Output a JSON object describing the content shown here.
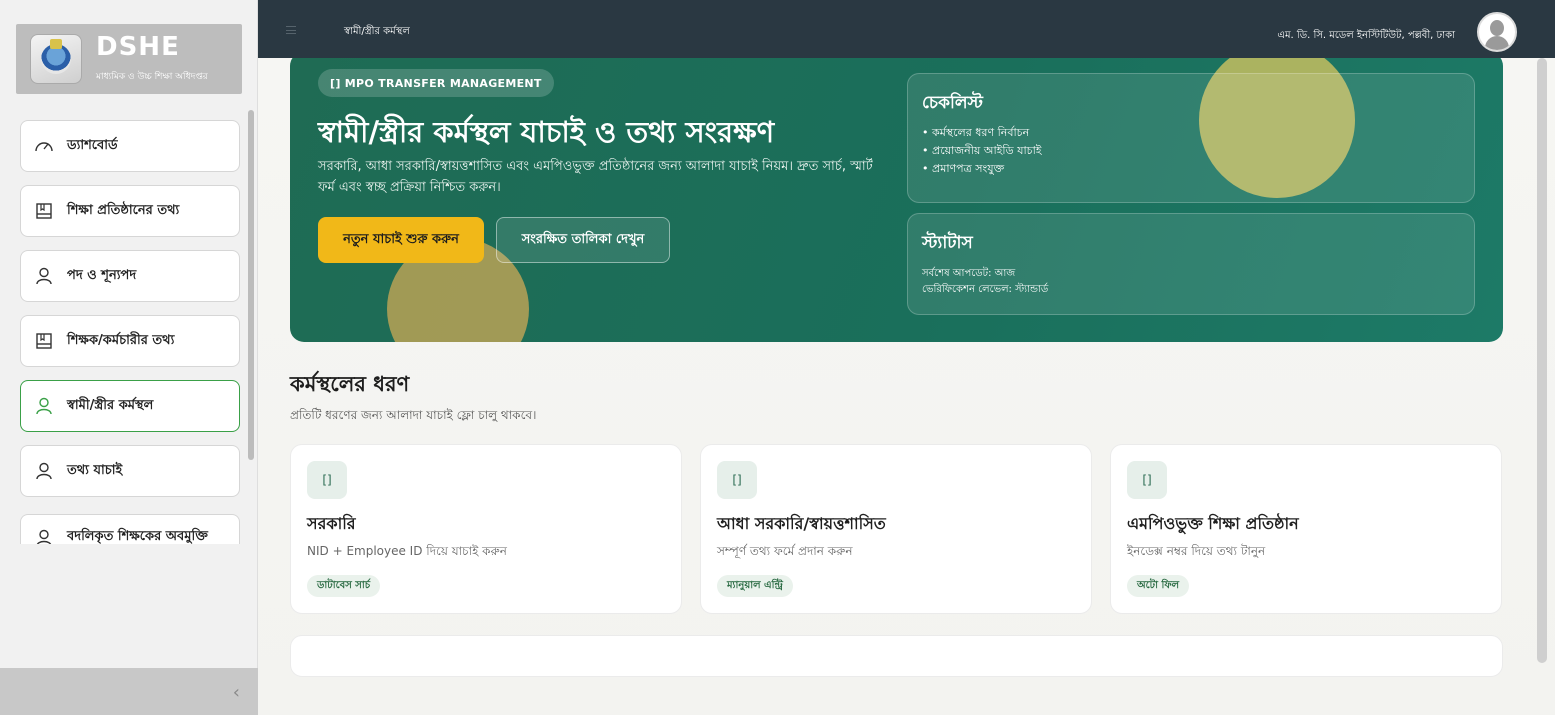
{
  "brand": {
    "title": "DSHE",
    "subtitle": "মাধ্যমিক ও উচ্চ শিক্ষা অধিদপ্তর"
  },
  "sidebar": {
    "items": [
      {
        "label": "ড্যাশবোর্ড",
        "icon": "dashboard-gauge-icon",
        "active": false
      },
      {
        "label": "শিক্ষা প্রতিষ্ঠানের তথ্য",
        "icon": "book-icon",
        "active": false
      },
      {
        "label": "পদ ও শূন্যপদ",
        "icon": "user-icon",
        "active": false
      },
      {
        "label": "শিক্ষক/কর্মচারীর তথ্য",
        "icon": "book-icon",
        "active": false
      },
      {
        "label": "স্বামী/স্ত্রীর কর্মস্থল",
        "icon": "user-icon",
        "active": true
      },
      {
        "label": "তথ্য যাচাই",
        "icon": "user-icon",
        "active": false
      },
      {
        "label": "বদলিকৃত শিক্ষকের অবমুক্তি",
        "icon": "user-icon",
        "active": false
      }
    ],
    "collapse_icon": "chevron-left-icon"
  },
  "topbar": {
    "page_title": "স্বামী/স্ত্রীর কর্মস্থল",
    "institution": "এম. ডি. সি. মডেল ইনস্টিটিউট, পল্লবী, ঢাকা",
    "avatar_icon": "user-avatar-icon"
  },
  "hero": {
    "badge": "[] MPO TRANSFER MANAGEMENT",
    "title": "স্বামী/স্ত্রীর কর্মস্থল যাচাই ও তথ্য সংরক্ষণ",
    "description": "সরকারি, আধা সরকারি/স্বায়ত্তশাসিত এবং এমপিওভুক্ত প্রতিষ্ঠানের জন্য আলাদা যাচাই নিয়ম। দ্রুত সার্চ, স্মার্ট ফর্ম এবং স্বচ্ছ প্রক্রিয়া নিশ্চিত করুন।",
    "primary_button": "নতুন যাচাই শুরু করুন",
    "secondary_button": "সংরক্ষিত তালিকা দেখুন",
    "accent_color": "#f1b818",
    "background_color": "#1d6f58"
  },
  "checklist": {
    "title": "চেকলিস্ট",
    "items": [
      "কর্মস্থলের ধরণ নির্বাচন",
      "প্রয়োজনীয় আইডি যাচাই",
      "প্রমাণপত্র সংযুক্ত"
    ]
  },
  "status": {
    "title": "স্ট্যাটাস",
    "last_update": "সর্বশেষ আপডেট: আজ",
    "level": "ভেরিফিকেশন লেভেল: স্ট্যান্ডার্ড"
  },
  "section": {
    "title": "কর্মস্থলের ধরণ",
    "subtitle": "প্রতিটি ধরণের জন্য আলাদা যাচাই ফ্লো চালু থাকবে।"
  },
  "cards": [
    {
      "icon_text": "[]",
      "title": "সরকারি",
      "desc": "NID + Employee ID দিয়ে যাচাই করুন",
      "tag": "ডাটাবেস সার্চ"
    },
    {
      "icon_text": "[]",
      "title": "আধা সরকারি/স্বায়ত্তশাসিত",
      "desc": "সম্পূর্ণ তথ্য ফর্মে প্রদান করুন",
      "tag": "ম্যানুয়াল এন্ট্রি"
    },
    {
      "icon_text": "[]",
      "title": "এমপিওভুক্ত শিক্ষা প্রতিষ্ঠান",
      "desc": "ইনডেক্স নম্বর দিয়ে তথ্য টানুন",
      "tag": "অটো ফিল"
    }
  ]
}
